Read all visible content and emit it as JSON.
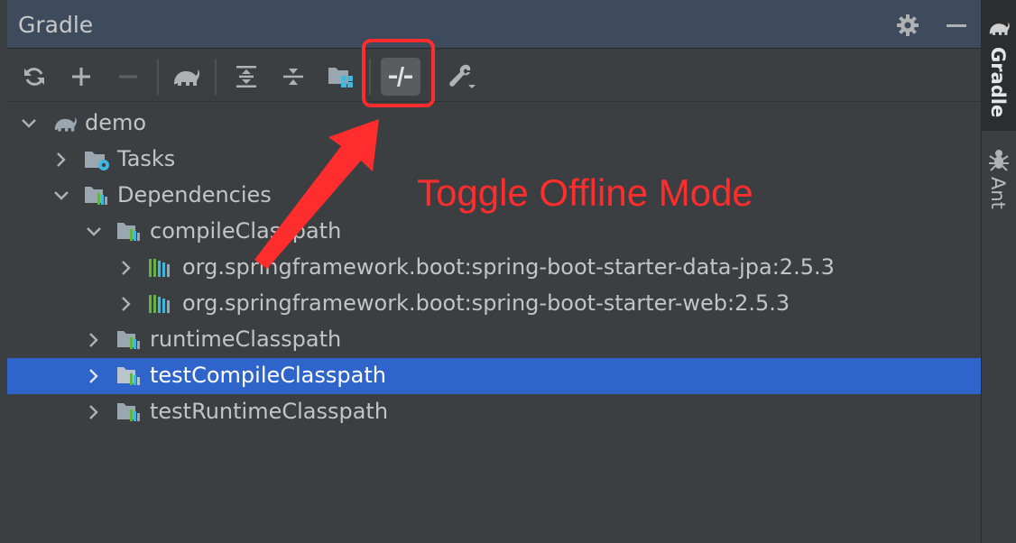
{
  "window": {
    "title": "Gradle"
  },
  "header_icons": [
    "gear-icon",
    "minimize-icon"
  ],
  "toolbar": {
    "buttons": [
      {
        "name": "reload-all-gradle-projects-button",
        "icon": "refresh-icon"
      },
      {
        "name": "link-gradle-project-button",
        "icon": "plus-icon"
      },
      {
        "name": "unlink-gradle-project-button",
        "icon": "minus-icon",
        "disabled": true
      },
      {
        "name": "execute-gradle-task-button",
        "icon": "elephant-icon"
      },
      {
        "name": "expand-all-button",
        "icon": "expand-all-icon"
      },
      {
        "name": "collapse-all-button",
        "icon": "collapse-all-icon"
      },
      {
        "name": "analyze-dependencies-button",
        "icon": "folder-grid-icon"
      },
      {
        "name": "toggle-offline-mode-button",
        "icon": "offline-icon",
        "pressed": true
      },
      {
        "name": "build-tool-settings-button",
        "icon": "wrench-icon"
      }
    ]
  },
  "tree": {
    "nodes": [
      {
        "label": "demo",
        "icon": "elephant-icon",
        "expanded": true
      },
      {
        "label": "Tasks",
        "icon": "tasks-folder-icon",
        "expanded": false
      },
      {
        "label": "Dependencies",
        "icon": "dependencies-folder-icon",
        "expanded": true
      },
      {
        "label": "compileClasspath",
        "icon": "dependencies-folder-icon",
        "expanded": true
      },
      {
        "label": "org.springframework.boot:spring-boot-starter-data-jpa:2.5.3",
        "icon": "library-icon",
        "expanded": false
      },
      {
        "label": "org.springframework.boot:spring-boot-starter-web:2.5.3",
        "icon": "library-icon",
        "expanded": false
      },
      {
        "label": "runtimeClasspath",
        "icon": "dependencies-folder-icon",
        "expanded": false
      },
      {
        "label": "testCompileClasspath",
        "icon": "dependencies-folder-icon",
        "expanded": false,
        "selected": true
      },
      {
        "label": "testRuntimeClasspath",
        "icon": "dependencies-folder-icon",
        "expanded": false
      }
    ]
  },
  "side_tabs": [
    {
      "label": "Gradle",
      "icon": "elephant-icon",
      "active": true
    },
    {
      "label": "Ant",
      "icon": "ant-icon",
      "active": false
    }
  ],
  "annotation": {
    "text": "Toggle Offline Mode",
    "color": "#ff2d2d"
  },
  "colors": {
    "selection": "#2f65ca",
    "header": "#3d4b5c",
    "panel": "#3c3f41"
  }
}
